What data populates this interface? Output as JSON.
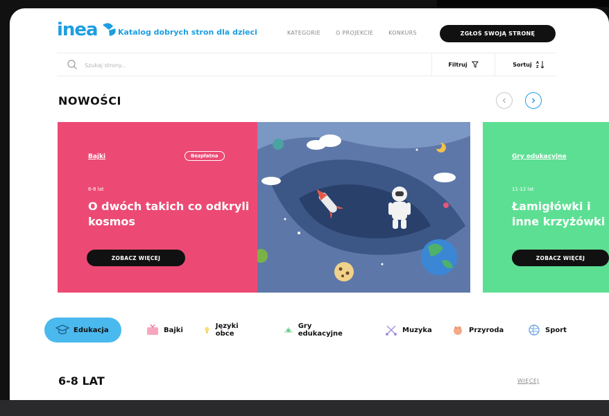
{
  "header": {
    "logo_text": "inea",
    "tagline": "Katalog dobrych stron dla dzieci",
    "nav": [
      "KATEGORIE",
      "O PROJEKCIE",
      "KONKURS"
    ],
    "cta_label": "ZGŁOŚ SWOJĄ STRONĘ"
  },
  "search": {
    "placeholder": "Szukaj strony...",
    "filter_label": "Filtruj",
    "sort_label": "Sortuj"
  },
  "section": {
    "title": "NOWOŚCI"
  },
  "cards": [
    {
      "category": "Bajki",
      "badge": "Bezpłatna",
      "age": "6-8 lat",
      "title": "O dwóch takich co odkryli kosmos",
      "button": "ZOBACZ WIĘCEJ",
      "color": "#ec4a74"
    },
    {
      "category": "Gry edukacyjne",
      "age": "11-12 lat",
      "title": "Łamigłówki i inne krzyżówki",
      "button": "ZOBACZ WIĘCEJ",
      "color": "#5ddf93"
    }
  ],
  "categories": [
    {
      "label": "Edukacja",
      "icon": "graduation-cap-icon",
      "active": true
    },
    {
      "label": "Bajki",
      "icon": "tv-icon",
      "active": false
    },
    {
      "label": "Języki obce",
      "icon": "lightbulb-icon",
      "active": false
    },
    {
      "label": "Gry edukacyjne",
      "icon": "game-icon",
      "active": false
    },
    {
      "label": "Muzyka",
      "icon": "music-icon",
      "active": false
    },
    {
      "label": "Przyroda",
      "icon": "nature-icon",
      "active": false
    },
    {
      "label": "Sport",
      "icon": "ball-icon",
      "active": false
    }
  ],
  "age_section": {
    "title": "6-8 LAT",
    "more_label": "WIĘCEJ"
  },
  "colors": {
    "accent": "#1d9ee0",
    "active_pill": "#4ab9ee",
    "pink": "#ec4a74",
    "green": "#5ddf93"
  }
}
